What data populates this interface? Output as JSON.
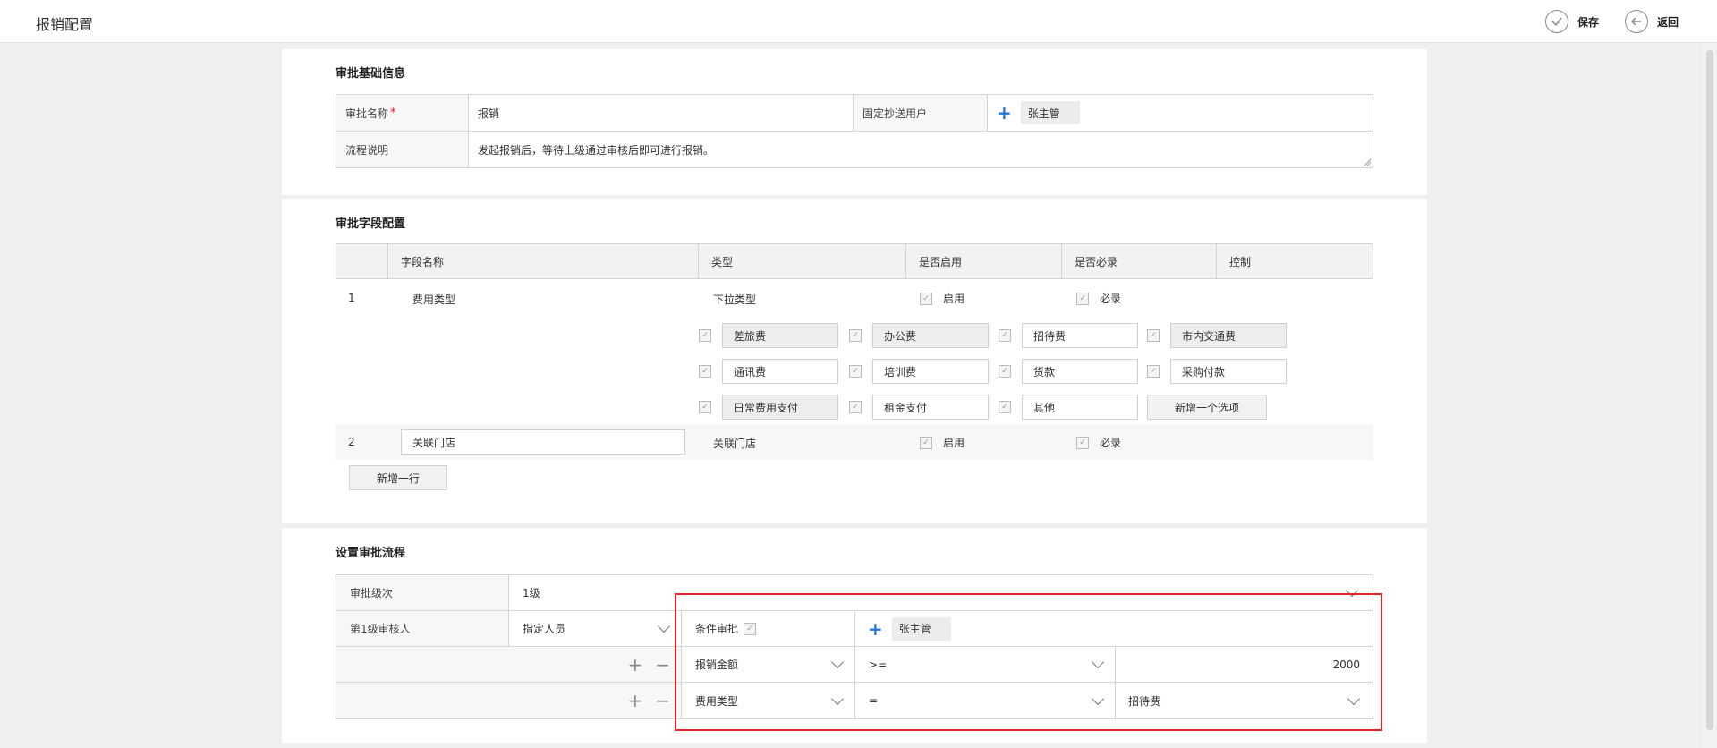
{
  "header": {
    "title": "报销配置",
    "save_label": "保存",
    "back_label": "返回"
  },
  "basic_info": {
    "heading": "审批基础信息",
    "name_label": "审批名称",
    "required_mark": "*",
    "name_value": "报销",
    "cc_label": "固定抄送用户",
    "cc_user": "张主管",
    "desc_label": "流程说明",
    "desc_value": "发起报销后，等待上级通过审核后即可进行报销。"
  },
  "fields": {
    "heading": "审批字段配置",
    "columns": [
      "字段名称",
      "类型",
      "是否启用",
      "是否必录",
      "控制"
    ],
    "rows": [
      {
        "index": "1",
        "name": "费用类型",
        "type": "下拉类型",
        "enabled": "启用",
        "required": "必录"
      },
      {
        "index": "2",
        "name": "关联门店",
        "type": "关联门店",
        "enabled": "启用",
        "required": "必录"
      }
    ],
    "options": [
      "差旅费",
      "办公费",
      "招待费",
      "市内交通费",
      "通讯费",
      "培训费",
      "货款",
      "采购付款",
      "日常费用支付",
      "租金支付",
      "其他"
    ],
    "add_option_label": "新增一个选项",
    "add_row_label": "新增一行"
  },
  "flow": {
    "heading": "设置审批流程",
    "level_label": "审批级次",
    "level_value": "1级",
    "reviewer_label": "第1级审核人",
    "reviewer_type": "指定人员",
    "condition_label": "条件审批",
    "condition_user": "张主管",
    "conditions": [
      {
        "field": "报销金额",
        "op": ">=",
        "value": "2000"
      },
      {
        "field": "费用类型",
        "op": "=",
        "value": "招待费"
      }
    ]
  },
  "colors": {
    "accent_blue": "#2b73d9",
    "highlight_red": "#e4242b"
  }
}
